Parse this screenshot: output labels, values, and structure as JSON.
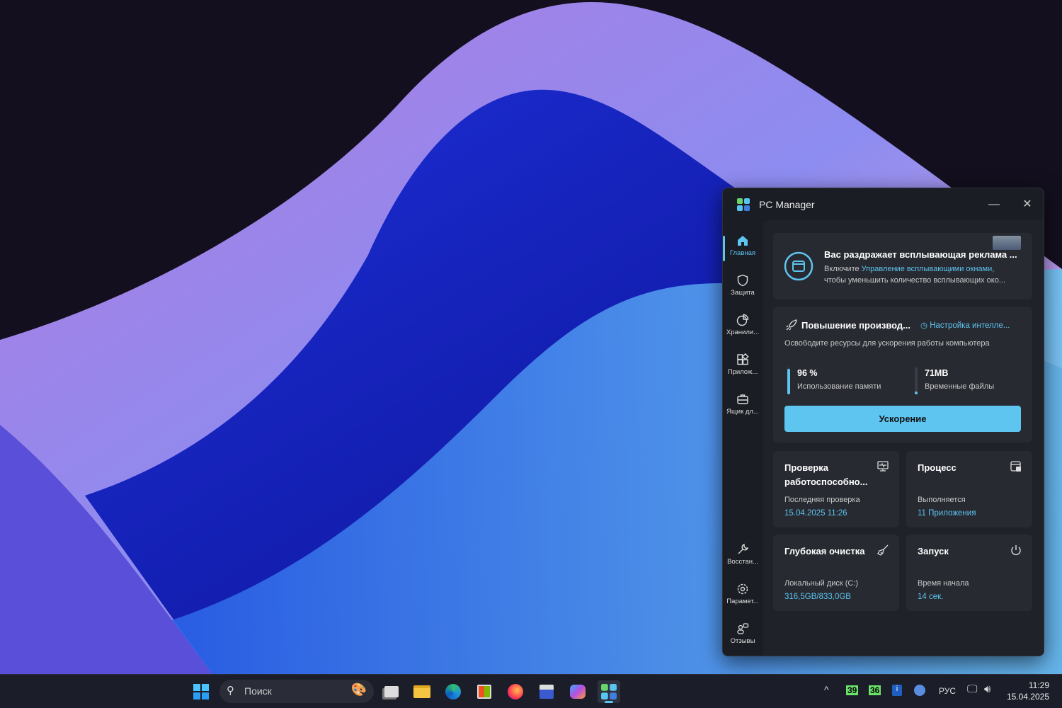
{
  "window": {
    "title": "PC Manager",
    "minimize_icon": "minimize-icon",
    "close_icon": "close-icon"
  },
  "sidebar": {
    "items": [
      {
        "label": "Главная",
        "icon": "home-icon",
        "active": true
      },
      {
        "label": "Защита",
        "icon": "shield-icon"
      },
      {
        "label": "Хранили...",
        "icon": "pie-chart-icon"
      },
      {
        "label": "Прилож...",
        "icon": "apps-icon"
      },
      {
        "label": "Ящик дл...",
        "icon": "toolbox-icon"
      }
    ],
    "bottom": [
      {
        "label": "Восстан...",
        "icon": "wrench-icon"
      },
      {
        "label": "Парамет...",
        "icon": "gear-icon"
      },
      {
        "label": "Отзывы",
        "icon": "feedback-icon"
      }
    ]
  },
  "promo": {
    "title": "Вас раздражает всплывающая реклама ...",
    "prefix": "Включите ",
    "link": "Управление всплывающими окнами,",
    "line2": "чтобы уменьшить количество всплывающих око..."
  },
  "boost": {
    "title": "Повышение производ...",
    "smart_link": "Настройка интелле...",
    "subtitle": "Освободите ресурсы для ускорения работы компьютера",
    "memory": {
      "value": "96 %",
      "label": "Использование памяти",
      "fraction": 0.96
    },
    "temp": {
      "value": "71MB",
      "label": "Временные файлы",
      "fraction": 0.05
    },
    "button": "Ускорение"
  },
  "tiles": [
    {
      "title": "Проверка работоспособно...",
      "label": "Последняя проверка",
      "value": "15.04.2025 11:26",
      "icon": "health-monitor-icon"
    },
    {
      "title": "Процесс",
      "label": "Выполняется",
      "value": "11 Приложения",
      "icon": "process-icon"
    },
    {
      "title": "Глубокая очистка",
      "label": "Локальный диск (C:)",
      "value": "316,5GB/833,0GB",
      "icon": "broom-icon"
    },
    {
      "title": "Запуск",
      "label": "Время начала",
      "value": "14 сек.",
      "icon": "power-icon"
    }
  ],
  "taskbar": {
    "search_placeholder": "Поиск",
    "tray": {
      "badge1": "39",
      "badge2": "36",
      "lang": "РУС",
      "time": "11:29",
      "date": "15.04.2025"
    }
  },
  "colors": {
    "accent": "#5ec4f0",
    "window_bg": "#1a1d24",
    "card_bg": "#272a31"
  }
}
